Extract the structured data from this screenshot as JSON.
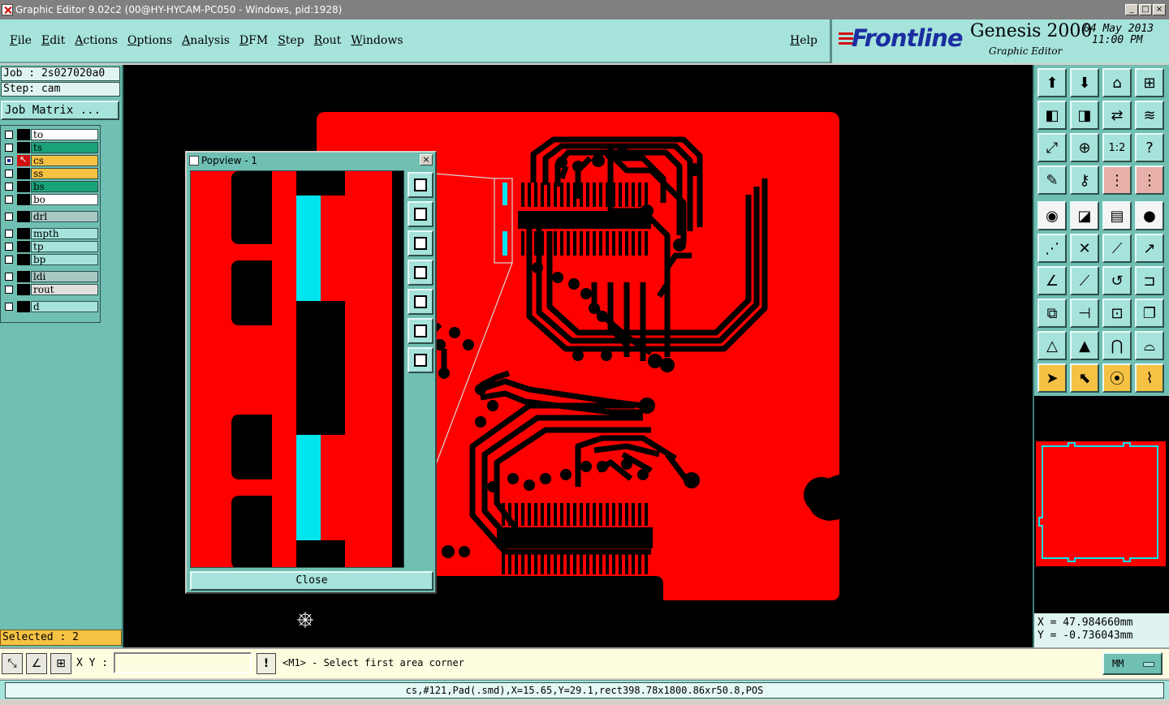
{
  "window": {
    "title": "Graphic Editor 9.02c2 (00@HY-HYCAM-PC050 - Windows, pid:1928)",
    "minimize": "_",
    "maximize": "□",
    "close": "×"
  },
  "menu": {
    "items": [
      "File",
      "Edit",
      "Actions",
      "Options",
      "Analysis",
      "DFM",
      "Step",
      "Rout",
      "Windows"
    ],
    "help": "Help"
  },
  "brand": {
    "logo": "Frontline",
    "product": "Genesis 2000",
    "subtitle": "Graphic Editor",
    "date": "04 May 2013",
    "time": "11:00 PM"
  },
  "left_panel": {
    "job": "Job : 2s027020a0",
    "step": "Step: cam",
    "job_matrix": "Job Matrix ...",
    "layers": [
      {
        "name": "to",
        "color": "#ffffff",
        "checked": false,
        "active": false
      },
      {
        "name": "ts",
        "color": "#1aa37a",
        "checked": false,
        "active": false
      },
      {
        "name": "cs",
        "color": "#f6c244",
        "checked": true,
        "active": true
      },
      {
        "name": "ss",
        "color": "#f6c244",
        "checked": false,
        "active": false
      },
      {
        "name": "bs",
        "color": "#1aa37a",
        "checked": false,
        "active": false
      },
      {
        "name": "bo",
        "color": "#ffffff",
        "checked": false,
        "active": false
      },
      {
        "name": "drl",
        "color": "#a8c8c4",
        "checked": false,
        "active": false
      },
      {
        "name": "mpth",
        "color": "#a6e3db",
        "checked": false,
        "active": false
      },
      {
        "name": "tp",
        "color": "#a6e3db",
        "checked": false,
        "active": false
      },
      {
        "name": "bp",
        "color": "#a6e3db",
        "checked": false,
        "active": false
      },
      {
        "name": "ldi",
        "color": "#a8c8c4",
        "checked": false,
        "active": false
      },
      {
        "name": "rout",
        "color": "#e0e0e0",
        "checked": false,
        "active": false
      },
      {
        "name": "d",
        "color": "#a6e3db",
        "checked": false,
        "active": false
      }
    ],
    "selected": "Selected : 2"
  },
  "popview": {
    "title": "Popview - 1",
    "close_x": "×",
    "close_button": "Close"
  },
  "toolbox": {
    "rows": [
      [
        "home-view-icon",
        "zoom-window-icon",
        "zoom-home-icon",
        "grid-icon"
      ],
      [
        "pan-left-icon",
        "pan-right-icon",
        "swap-icon",
        "layers-icon"
      ],
      [
        "fit-icon",
        "zoom-in-icon",
        "scale-1-2-icon",
        "help-icon"
      ],
      [
        "measure-icon",
        "key-icon",
        "net-select-icon",
        "net-highlight-icon"
      ],
      [
        "snap-icon",
        "line-color-icon",
        "ruler-icon",
        "pad-icon"
      ],
      [
        "node-icon",
        "cross-icon",
        "point-line-icon",
        "point-arrow-icon"
      ],
      [
        "angle-icon",
        "diagonal-icon",
        "arc-icon",
        "feature-icon"
      ],
      [
        "copy-icon",
        "split-icon",
        "center-icon",
        "stack-icon"
      ],
      [
        "triangle-icon",
        "triangle-select-icon",
        "arch-icon",
        "arch-select-icon"
      ],
      [
        "pointer-icon",
        "pointer-box-icon",
        "pointer-circle-icon",
        "route-icon"
      ]
    ],
    "glyphs": {
      "home-view-icon": "⬆",
      "zoom-window-icon": "⬇",
      "zoom-home-icon": "⌂",
      "grid-icon": "⊞",
      "pan-left-icon": "◧",
      "pan-right-icon": "◨",
      "swap-icon": "⇄",
      "layers-icon": "≋",
      "fit-icon": "⤢",
      "zoom-in-icon": "⊕",
      "scale-1-2-icon": "1:2",
      "help-icon": "?",
      "measure-icon": "✎",
      "key-icon": "⚷",
      "net-select-icon": "⋮",
      "net-highlight-icon": "⋮",
      "snap-icon": "◉",
      "line-color-icon": "◪",
      "ruler-icon": "▤",
      "pad-icon": "●",
      "node-icon": "⋰",
      "cross-icon": "✕",
      "point-line-icon": "⟋",
      "point-arrow-icon": "↗",
      "angle-icon": "∠",
      "diagonal-icon": "⟋",
      "arc-icon": "↺",
      "feature-icon": "⊐",
      "copy-icon": "⧉",
      "split-icon": "⊣",
      "center-icon": "⊡",
      "stack-icon": "❐",
      "triangle-icon": "△",
      "triangle-select-icon": "▲",
      "arch-icon": "⋂",
      "arch-select-icon": "⌓",
      "pointer-icon": "➤",
      "pointer-box-icon": "⬉",
      "pointer-circle-icon": "⦿",
      "route-icon": "⌇"
    }
  },
  "coords": {
    "x": "X = 47.984660mm",
    "y": "Y = -0.736043mm"
  },
  "bottom": {
    "xy_label": "X Y :",
    "xy_value": "",
    "bang": "!",
    "prompt": "<M1> - Select first area corner",
    "units": "MM"
  },
  "status": "cs,#121,Pad(.smd),X=15.65,Y=29.1,rect398.78x1800.86xr50.8,POS",
  "colors": {
    "copper": "#ff0000",
    "smd_selected": "#00e5ee",
    "canvas_bg": "#000000",
    "panel": "#6fbfb3",
    "panel_light": "#a6e3db"
  }
}
